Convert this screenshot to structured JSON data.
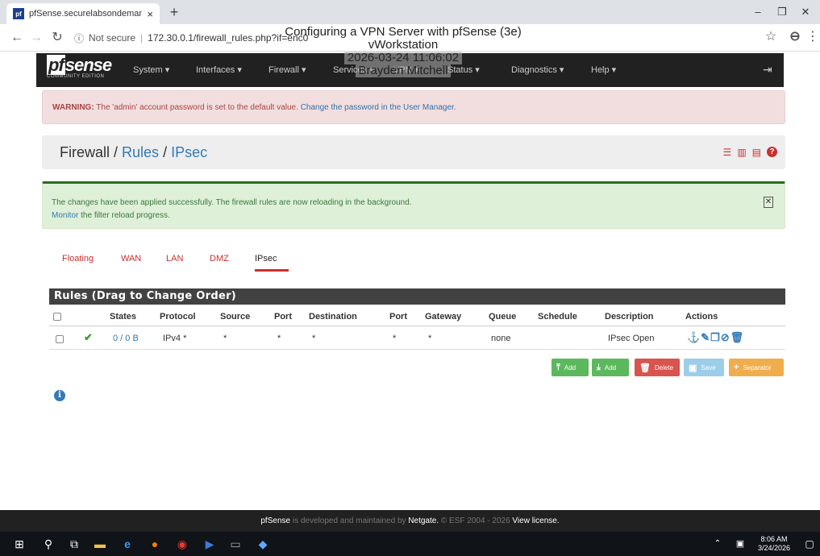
{
  "browser": {
    "tab_title": "pfSense.securelabsondemand.co",
    "tab_favicon": "pf",
    "tab_close": "×",
    "new_tab": "+",
    "win_min": "–",
    "win_max": "❐",
    "win_close": "✕",
    "not_secure": "Not secure",
    "url": "172.30.0.1/firewall_rules.php?if=enc0"
  },
  "overlay": {
    "line1": "Configuring a VPN Server with pfSense (3e)",
    "line2": "vWorkstation",
    "line3": "2026-03-24 11:06:02",
    "line4": "Brayden Mitchell"
  },
  "nav": {
    "logo": "sense",
    "logo_pf": "pf",
    "edition": "COMMUNITY EDITION",
    "items": [
      "System ▾",
      "Interfaces ▾",
      "Firewall ▾",
      "Services ▾",
      "VPN ▾",
      "Status ▾",
      "Diagnostics ▾",
      "Help ▾"
    ]
  },
  "warning": {
    "bold": "WARNING:",
    "text": " The 'admin' account password is set to the default value. ",
    "link": "Change the password in the User Manager."
  },
  "breadcrumb": {
    "first": "Firewall",
    "sep": " / ",
    "second": "Rules",
    "third": "IPsec"
  },
  "success": {
    "line1": "The changes have been applied successfully. The firewall rules are now reloading in the background.",
    "link": "Monitor",
    "line2": " the filter reload progress."
  },
  "tabs": [
    "Floating",
    "WAN",
    "LAN",
    "DMZ",
    "IPsec"
  ],
  "table": {
    "title": "Rules (Drag to Change Order)",
    "headers": [
      "States",
      "Protocol",
      "Source",
      "Port",
      "Destination",
      "Port",
      "Gateway",
      "Queue",
      "Schedule",
      "Description",
      "Actions"
    ],
    "rows": [
      {
        "states": "0 / 0 B",
        "protocol": "IPv4 *",
        "source": "*",
        "port": "*",
        "destination": "*",
        "dport": "*",
        "gateway": "*",
        "queue": "none",
        "schedule": "",
        "description": "IPsec Open"
      }
    ]
  },
  "buttons": {
    "add_top": "Add",
    "add_bottom": "Add",
    "delete": "Delete",
    "save": "Save",
    "separator": "Separator"
  },
  "footer": {
    "brand": "pfSense",
    "text": " is developed and maintained by ",
    "netgate": "Netgate.",
    "copy": " © ESF 2004 - 2026 ",
    "license": "View license."
  },
  "taskbar": {
    "time": "8:06 AM",
    "date": "3/24/2026"
  },
  "colors": {
    "nav_bg": "#212121",
    "danger": "#c9302c",
    "success": "#3c763d",
    "link": "#337ab7"
  }
}
